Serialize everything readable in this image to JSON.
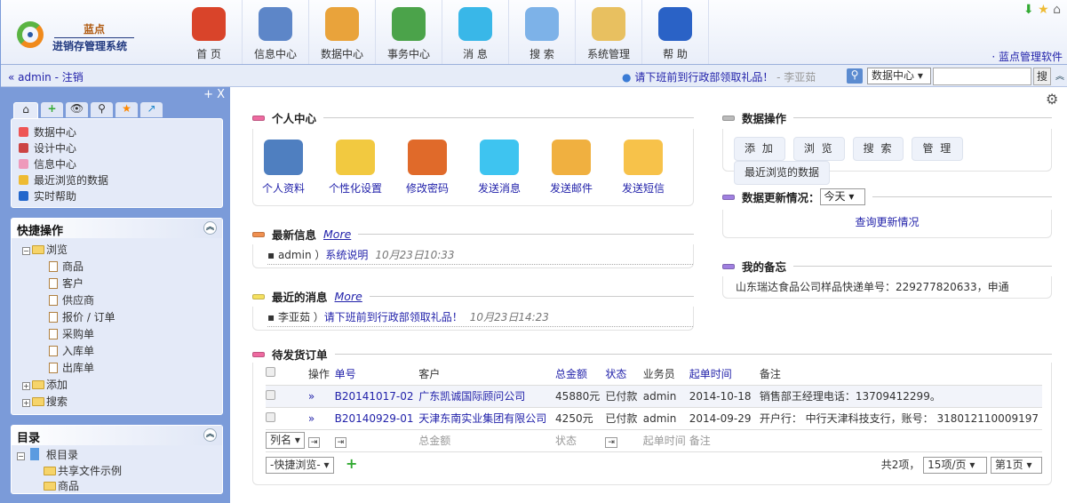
{
  "header": {
    "logo_top": "蓝点",
    "logo_bottom": "进销存管理系统",
    "brand": "· 蓝点管理软件",
    "nav": [
      {
        "label": "首 页",
        "color": "#d9442a"
      },
      {
        "label": "信息中心",
        "color": "#5d86c8"
      },
      {
        "label": "数据中心",
        "color": "#e9a33b"
      },
      {
        "label": "事务中心",
        "color": "#4ba34a"
      },
      {
        "label": "消 息",
        "color": "#39b7e8"
      },
      {
        "label": "搜 索",
        "color": "#7db2e8"
      },
      {
        "label": "系统管理",
        "color": "#e8c060"
      },
      {
        "label": "帮 助",
        "color": "#2a62c6"
      }
    ]
  },
  "subbar": {
    "user": "admin",
    "logout": "注销",
    "notice": "请下班前到行政部领取礼品！",
    "notice_author": "- 李亚茹",
    "search_scope": "数据中心",
    "search_value": "",
    "search_button": "搜"
  },
  "sidebar": {
    "tab_items": [
      "数据中心",
      "设计中心",
      "信息中心",
      "最近浏览的数据",
      "实时帮助"
    ],
    "quick": {
      "title": "快捷操作",
      "root": "浏览",
      "children": [
        "商品",
        "客户",
        "供应商",
        "报价 / 订单",
        "采购单",
        "入库单",
        "出库单"
      ],
      "others": [
        "添加",
        "搜索"
      ]
    },
    "dir": {
      "title": "目录",
      "root": "根目录",
      "children": [
        "共享文件示例",
        "商品"
      ]
    }
  },
  "personal": {
    "title": "个人中心",
    "items": [
      {
        "label": "个人资料",
        "color": "#4f7fc0"
      },
      {
        "label": "个性化设置",
        "color": "#f2c940"
      },
      {
        "label": "修改密码",
        "color": "#e06a2a"
      },
      {
        "label": "发送消息",
        "color": "#3ec4f0"
      },
      {
        "label": "发送邮件",
        "color": "#f0b040"
      },
      {
        "label": "发送短信",
        "color": "#f7c24a"
      }
    ]
  },
  "news": {
    "title": "最新信息",
    "more": "More",
    "items": [
      {
        "author": "admin ）",
        "text": "系统说明",
        "date": "10月23日10:33"
      }
    ]
  },
  "messages": {
    "title": "最近的消息",
    "more": "More",
    "items": [
      {
        "author": "李亚茹 ）",
        "text": "请下班前到行政部领取礼品！",
        "date": "10月23日14:23"
      }
    ]
  },
  "data_ops": {
    "title": "数据操作",
    "buttons": [
      "添 加",
      "浏 览",
      "搜 索",
      "管 理",
      "最近浏览的数据"
    ]
  },
  "updates": {
    "title": "数据更新情况：",
    "period": "今天",
    "link": "查询更新情况"
  },
  "memo": {
    "title": "我的备忘",
    "text": "山东瑞达食品公司样品快递单号：229277820633，申通"
  },
  "orders": {
    "title": "待发货订单",
    "headers": [
      "操作",
      "单号",
      "客户",
      "总金额",
      "状态",
      "业务员",
      "起单时间",
      "备注"
    ],
    "rows": [
      [
        "»",
        "B20141017-02",
        "广东凯诚国际顾问公司",
        "45880元",
        "已付款",
        "admin",
        "2014-10-18",
        "销售部王经理电话：13709412299。"
      ],
      [
        "»",
        "B20140929-01",
        "天津东南实业集团有限公司",
        "4250元",
        "已付款",
        "admin",
        "2014-09-29",
        "开户行： 中行天津科技支行，账号： 318012110009197"
      ]
    ],
    "col_select": "列名",
    "footer_cols": [
      "总金额",
      "状态",
      "起单时间",
      "备注"
    ],
    "quick_browse": "-快捷浏览-",
    "total": "共2项，",
    "per_page": "15项/页",
    "page": "第1页"
  }
}
